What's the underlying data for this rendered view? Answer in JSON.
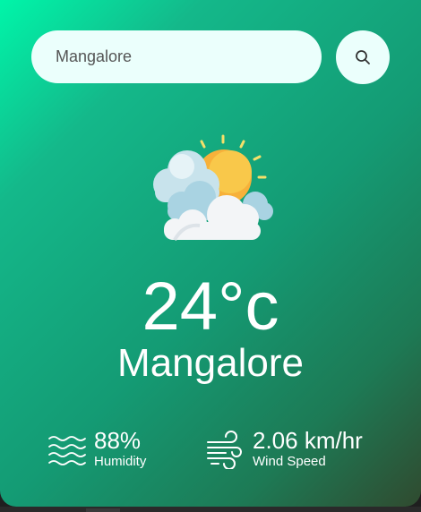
{
  "search": {
    "value": "Mangalore",
    "icon": "search-icon"
  },
  "weather": {
    "icon": "partly-cloudy-icon",
    "temperature": "24°c",
    "city": "Mangalore"
  },
  "humidity": {
    "icon": "humidity-icon",
    "value": "88%",
    "label": "Humidity"
  },
  "wind": {
    "icon": "wind-icon",
    "value": "2.06 km/hr",
    "label": "Wind Speed"
  },
  "colors": {
    "gradient_start": "#00f5a9",
    "gradient_end": "#304a2f",
    "search_bg": "#ebfffc",
    "text": "#ffffff"
  }
}
